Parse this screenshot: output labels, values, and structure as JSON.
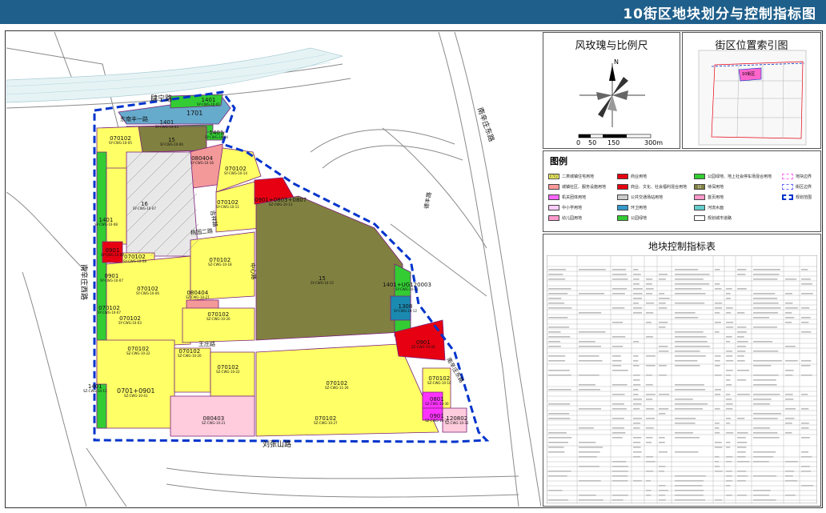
{
  "header": {
    "title": "10街区地块划分与控制指标图"
  },
  "compass": {
    "title": "风玫瑰与比例尺",
    "north": "N",
    "scale_labels": [
      "0",
      "50",
      "150",
      "300m"
    ]
  },
  "index_map": {
    "title": "街区位置索引图",
    "highlight_label": "10街区"
  },
  "legend": {
    "title": "图例",
    "items": [
      {
        "label": "二类城镇住宅用地",
        "color": "#ffff66",
        "code": "0702"
      },
      {
        "label": "商业用地",
        "color": "#e60012",
        "code": ""
      },
      {
        "label": "公园绿地、地上社会停车场混合用地",
        "color": "#33cc33",
        "code": ""
      },
      {
        "label": "地块边界",
        "color": "#ff66ff",
        "code": ""
      },
      {
        "label": "城镇社区、服务设施用地",
        "color": "#ff9999",
        "code": ""
      },
      {
        "label": "商业、文化、社会福利混合用地",
        "color": "#e60012",
        "code": ""
      },
      {
        "label": "待深用地",
        "color": "#808040",
        "code": "15"
      },
      {
        "label": "街区边界",
        "color": "#6666ff",
        "code": ""
      },
      {
        "label": "机关团体用地",
        "color": "#ff66ff",
        "code": ""
      },
      {
        "label": "公共交通场站用地",
        "color": "#cccccc",
        "code": ""
      },
      {
        "label": "首页用地",
        "color": "#ff99cc",
        "code": ""
      },
      {
        "label": "规划范围",
        "color": "#0033cc",
        "code": ""
      },
      {
        "label": "中小学用地",
        "color": "#ffccff",
        "code": ""
      },
      {
        "label": "环卫用地",
        "color": "#3399cc",
        "code": ""
      },
      {
        "label": "河流水面",
        "color": "#66cccc",
        "code": ""
      },
      {
        "label": "幼儿园用地",
        "color": "#ff99cc",
        "code": ""
      },
      {
        "label": "公园绿地",
        "color": "#33cc33",
        "code": ""
      },
      {
        "label": "规划城市道路",
        "color": "#ffffff",
        "code": ""
      }
    ]
  },
  "control_table": {
    "title": "地块控制指标表"
  },
  "map": {
    "roads": [
      {
        "id": "suining",
        "text": "肆宁路"
      },
      {
        "id": "dongnanfeng",
        "text": "东南丰一路"
      },
      {
        "id": "nanxin_dong",
        "text": "南辛庄东路"
      },
      {
        "id": "nanxin_xi",
        "text": "南辛庄西路"
      },
      {
        "id": "liuxian",
        "text": "刘张山路"
      },
      {
        "id": "wangjia",
        "text": "王庄路"
      },
      {
        "id": "dongfeng",
        "text": "德丰路"
      },
      {
        "id": "jiaoti",
        "text": "桃园二路"
      },
      {
        "id": "jixiang",
        "text": "吉祥路"
      },
      {
        "id": "zhonglu",
        "text": "中心路"
      },
      {
        "id": "yunyu",
        "text": "南辛庄东路"
      }
    ],
    "parcels": [
      {
        "code": "1401",
        "sub": "SY-CWG-10-01"
      },
      {
        "code": "1701",
        "sub": ""
      },
      {
        "code": "1401",
        "sub": "SY-CWG-10-03"
      },
      {
        "code": "1401",
        "sub": "SY-CWG-10-04"
      },
      {
        "code": "070102",
        "sub": "SY-CWG-10-05"
      },
      {
        "code": "15",
        "sub": "SY-CWG-10-06"
      },
      {
        "code": "080404",
        "sub": "SY-CWG-10-16"
      },
      {
        "code": "16",
        "sub": "SY-CWG-10-07"
      },
      {
        "code": "070102",
        "sub": "SY-CWG-10-14"
      },
      {
        "code": "0901+0803+0807",
        "sub": "SZ-CWG-10-13"
      },
      {
        "code": "070102",
        "sub": "SY-CWG-10-11"
      },
      {
        "code": "1401",
        "sub": "SY-CWG-10-08"
      },
      {
        "code": "0901",
        "sub": "SY-CWG-10-09"
      },
      {
        "code": "070102",
        "sub": "SY-CWG-10-08"
      },
      {
        "code": "0901",
        "sub": "SY-CWG-10-07"
      },
      {
        "code": "070102",
        "sub": "SZ-CWG-10-18"
      },
      {
        "code": "15",
        "sub": "SY-CWG-10-15"
      },
      {
        "code": "070102",
        "sub": "SY-CWG-10-06"
      },
      {
        "code": "080404",
        "sub": "SZ-CWG-10-27"
      },
      {
        "code": "070102",
        "sub": "SY-CWG-10-07"
      },
      {
        "code": "070102",
        "sub": "SY-CWG-10-03"
      },
      {
        "code": "070102",
        "sub": "SZ-CWG-10-20"
      },
      {
        "code": "1401+UG120003",
        "sub": "SY-CWG-10-11"
      },
      {
        "code": "1308",
        "sub": "SY-CWG-10-12"
      },
      {
        "code": "0901",
        "sub": "SZ-CWG-10-26"
      },
      {
        "code": "070102",
        "sub": "SZ-CWG-10-22"
      },
      {
        "code": "070102",
        "sub": "SZ-CWG-10-20"
      },
      {
        "code": "070102",
        "sub": "SZ-CWG-10-22"
      },
      {
        "code": "070102",
        "sub": "SZ-CWG-11-26"
      },
      {
        "code": "070102",
        "sub": "SZ-CWG-10-10"
      },
      {
        "code": "1401",
        "sub": "SZ-CWG-10-11"
      },
      {
        "code": "0701+0901",
        "sub": "SZ-CWG-10-41"
      },
      {
        "code": "080403",
        "sub": "SZ-CWG-10-21"
      },
      {
        "code": "070102",
        "sub": "SZ-CWG-10-27"
      },
      {
        "code": "0801",
        "sub": "SZ-CWG-10-30"
      },
      {
        "code": "0901",
        "sub": "SZ-CWG-10-31"
      },
      {
        "code": "120802",
        "sub": "SZ-CWG-10-32"
      }
    ]
  },
  "colors": {
    "header_bg": "#1f5f8b",
    "residential": "#ffff66",
    "commercial": "#e60012",
    "green": "#33cc33",
    "undetermined": "#808040",
    "school": "#ffccff",
    "community": "#ff9999",
    "boundary": "#0033cc",
    "water": "#66cccc"
  }
}
